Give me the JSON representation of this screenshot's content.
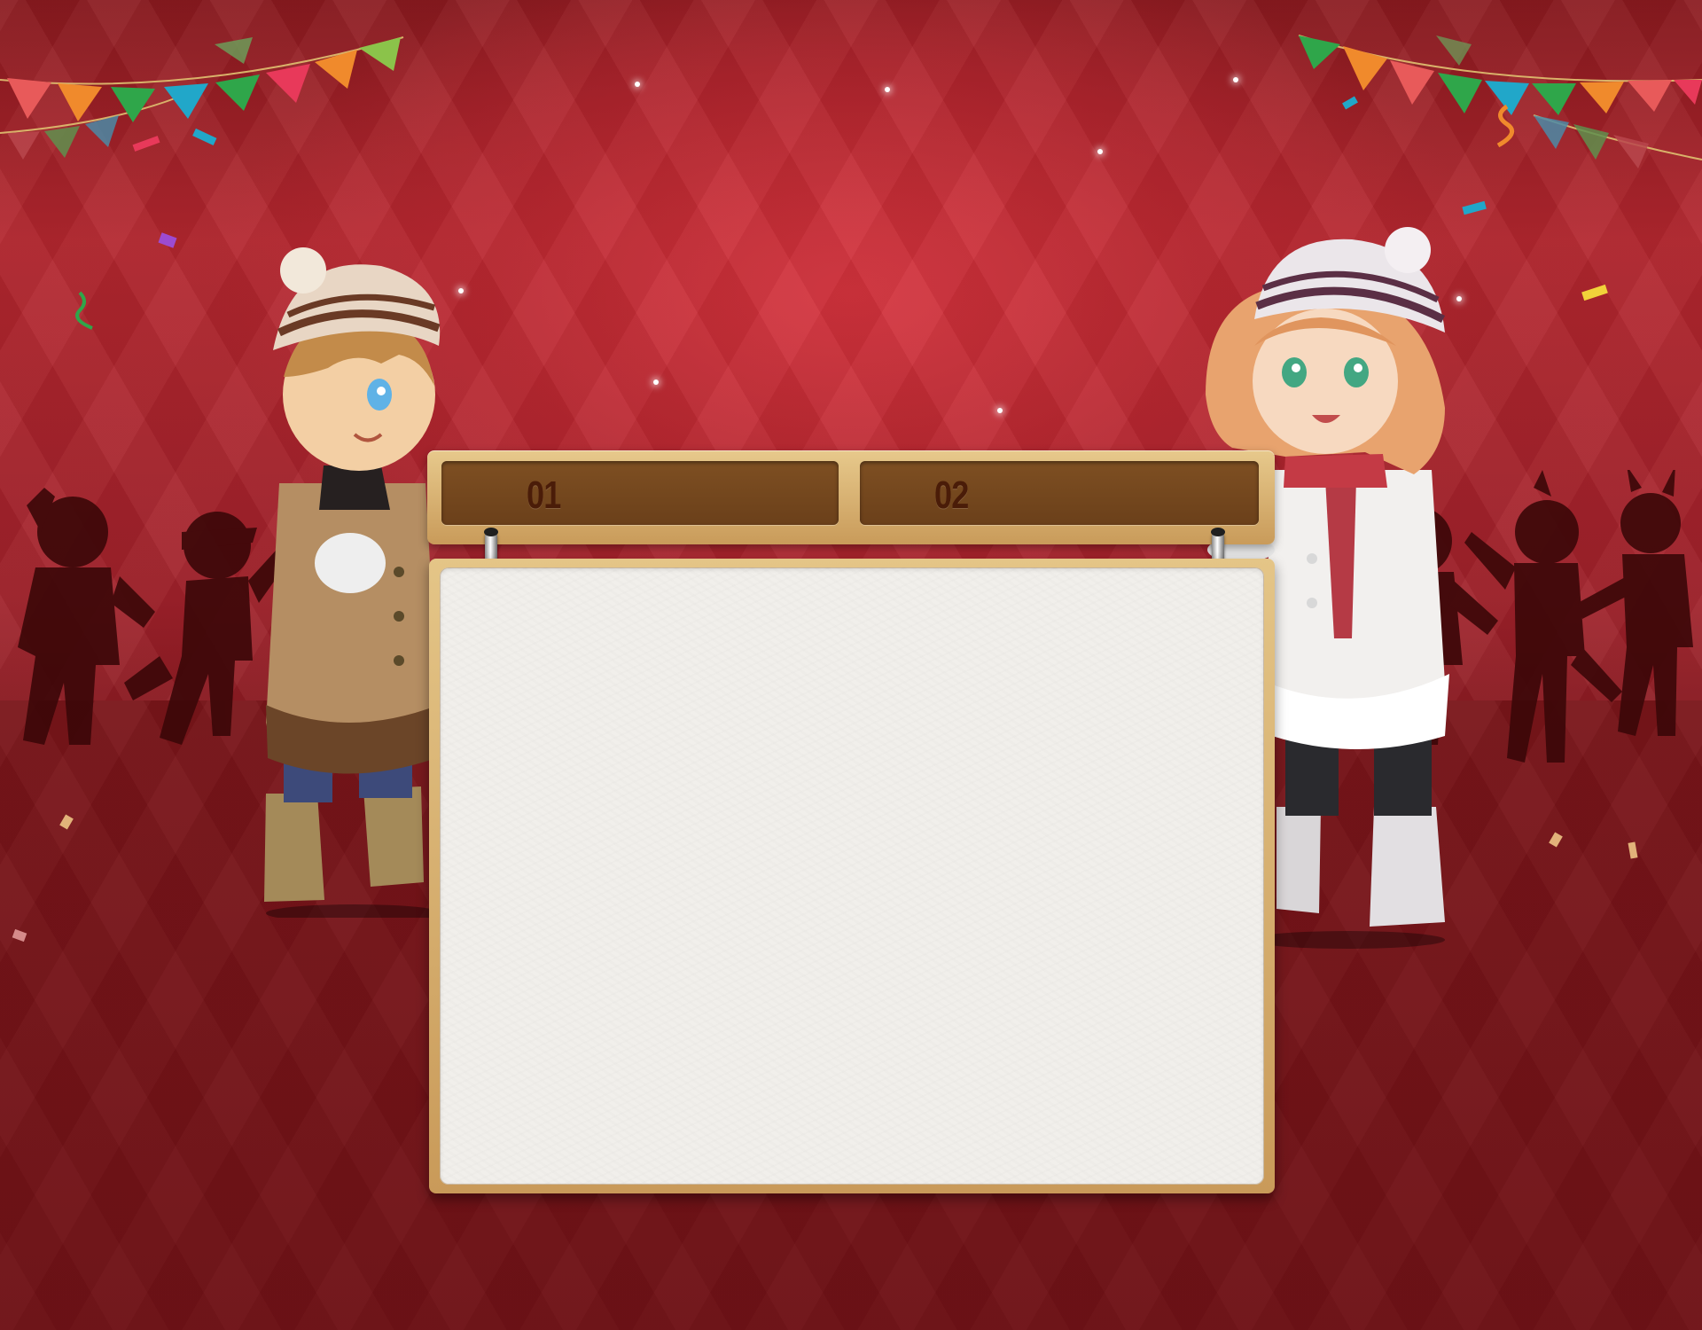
{
  "scene": {
    "background_color": "#a3232b",
    "floor_color": "#7a151a"
  },
  "board": {
    "tabs": [
      {
        "label": "01",
        "color": "#6b401a",
        "text_color": "#4a1c08"
      },
      {
        "label": "02",
        "color": "#6b401a",
        "text_color": "#4a1c08"
      }
    ],
    "frame_color": "#d6b172",
    "paper_color": "#f1efeb"
  },
  "characters": {
    "left": {
      "icon": "boy-in-knit-hat-character"
    },
    "right": {
      "icon": "girl-in-knit-hat-character"
    }
  },
  "decorations": {
    "bunting_colors": [
      "#e85a5a",
      "#f08a2c",
      "#2fa64a",
      "#21a7c9",
      "#e8395a",
      "#8bc34a"
    ]
  }
}
